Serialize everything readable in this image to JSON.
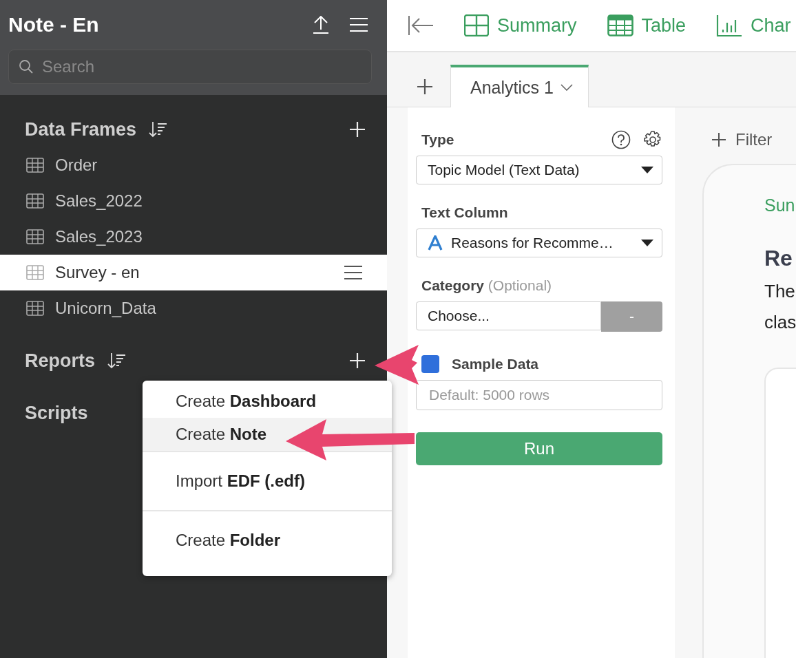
{
  "sidebar": {
    "title": "Note - En",
    "search": {
      "placeholder": "Search"
    },
    "sections": [
      {
        "title": "Data Frames",
        "kind": "sorted",
        "items": [
          {
            "label": "Order",
            "selected": false
          },
          {
            "label": "Sales_2022",
            "selected": false
          },
          {
            "label": "Sales_2023",
            "selected": false
          },
          {
            "label": "Survey - en",
            "selected": true
          },
          {
            "label": "Unicorn_Data",
            "selected": false
          }
        ]
      },
      {
        "title": "Reports",
        "kind": "sorted"
      },
      {
        "title": "Scripts",
        "kind": "plain"
      }
    ]
  },
  "toolbar": {
    "views": [
      {
        "label": "Summary",
        "kind": "summary"
      },
      {
        "label": "Table",
        "kind": "table"
      },
      {
        "label": "Char",
        "kind": "chart"
      }
    ]
  },
  "tabs": [
    {
      "label": "Analytics 1",
      "selected": true
    }
  ],
  "form": {
    "type": {
      "label": "Type",
      "value": "Topic Model (Text Data)"
    },
    "text_column": {
      "label": "Text Column",
      "value": "Reasons for Recomme…"
    },
    "category": {
      "label": "Category",
      "hint": "(Optional)",
      "value": "Choose...",
      "button": "-"
    },
    "sample_data": {
      "label": "Sample Data",
      "checked": true,
      "placeholder": "Default: 5000 rows"
    },
    "run": "Run"
  },
  "filter": "Filter",
  "result": {
    "tab": "Sun",
    "heading": "Re",
    "lines": [
      "The",
      "clas"
    ]
  },
  "menu": {
    "items": [
      {
        "text": "Create **Dashboard**",
        "selected": false,
        "separated": false
      },
      {
        "text": "Create **Note**",
        "selected": true,
        "separated": false
      },
      {
        "text": "Import **EDF (.edf)**",
        "selected": false,
        "separated": true
      },
      {
        "text": "Create **Folder**",
        "selected": false,
        "separated": true
      }
    ]
  }
}
